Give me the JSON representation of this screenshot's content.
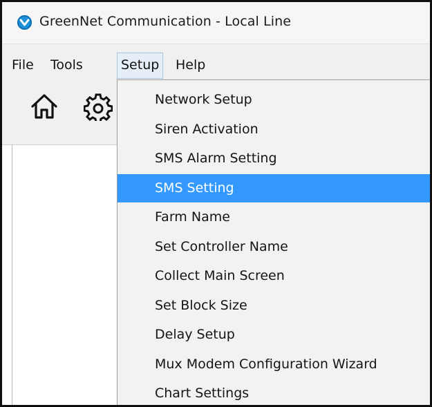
{
  "window": {
    "title": "GreenNet Communication - Local Line"
  },
  "menubar": {
    "items": [
      {
        "label": "File"
      },
      {
        "label": "Tools"
      },
      {
        "label": "Setup"
      },
      {
        "label": "Help"
      }
    ],
    "active": "Setup"
  },
  "toolbar": {
    "icons": [
      "home-icon",
      "gear-icon"
    ]
  },
  "setup_menu": {
    "items": [
      {
        "label": "Network Setup"
      },
      {
        "label": "Siren Activation"
      },
      {
        "label": "SMS Alarm Setting"
      },
      {
        "label": "SMS Setting"
      },
      {
        "label": "Farm Name"
      },
      {
        "label": "Set Controller Name"
      },
      {
        "label": "Collect Main Screen"
      },
      {
        "label": "Set Block Size"
      },
      {
        "label": "Delay Setup"
      },
      {
        "label": "Mux Modem Configuration Wizard"
      },
      {
        "label": "Chart Settings"
      }
    ],
    "highlighted": "SMS Setting"
  },
  "colors": {
    "highlight": "#3399ff",
    "app_icon": "#1f8fd8"
  }
}
